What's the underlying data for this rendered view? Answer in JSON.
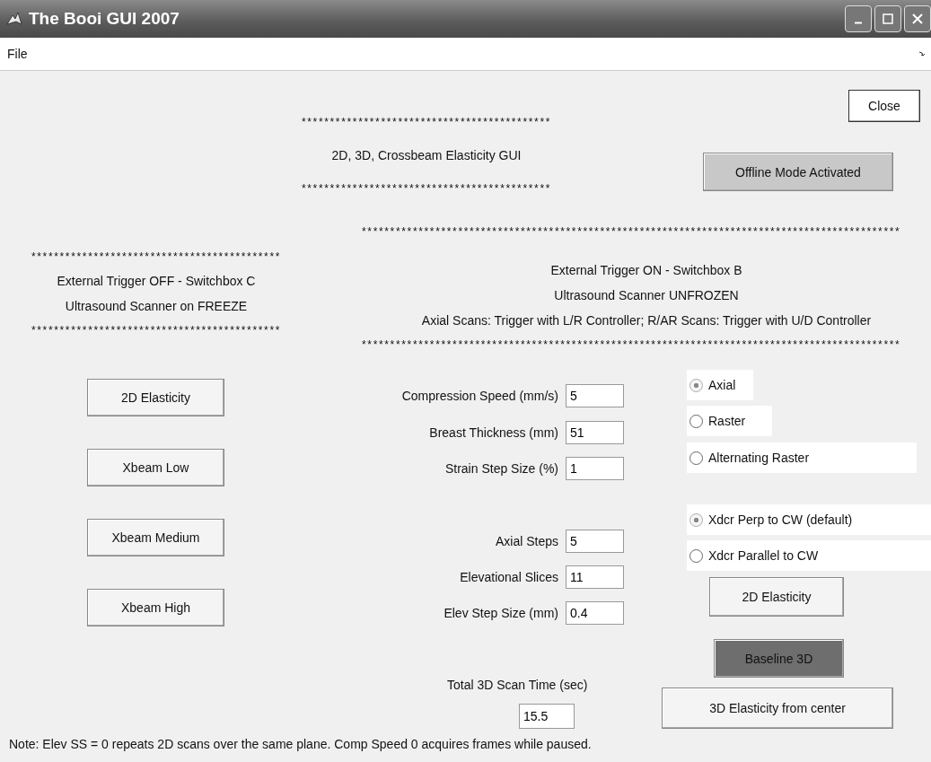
{
  "window": {
    "title": "The Booi GUI 2007"
  },
  "menu": [
    "File"
  ],
  "close_button": "Close",
  "header": {
    "stars_top": "********************************************",
    "title": "2D, 3D, Crossbeam Elasticity GUI",
    "stars_bottom": "********************************************"
  },
  "offline_button": "Offline Mode Activated",
  "left_status": {
    "stars_top": "********************************************",
    "lines": [
      "External Trigger OFF - Switchbox C",
      "Ultrasound Scanner on FREEZE"
    ],
    "stars_bottom": "********************************************"
  },
  "right_status": {
    "stars_top": "***********************************************************************************************",
    "lines": [
      "External Trigger ON - Switchbox B",
      "Ultrasound Scanner UNFROZEN",
      "Axial Scans: Trigger with L/R Controller; R/AR Scans: Trigger with U/D Controller"
    ],
    "stars_bottom": "***********************************************************************************************"
  },
  "left_buttons": [
    "2D Elasticity",
    "Xbeam Low",
    "Xbeam Medium",
    "Xbeam High"
  ],
  "fields": [
    {
      "label": "Compression Speed (mm/s)",
      "value": "5"
    },
    {
      "label": "Breast Thickness (mm)",
      "value": "51"
    },
    {
      "label": "Strain Step Size (%)",
      "value": "1"
    },
    {
      "label": "Axial Steps",
      "value": "5"
    },
    {
      "label": "Elevational Slices",
      "value": "11"
    },
    {
      "label": "Elev Step Size (mm)",
      "value": "0.4"
    }
  ],
  "scan_modes": [
    {
      "label": "Axial",
      "selected": true
    },
    {
      "label": "Raster",
      "selected": false
    },
    {
      "label": "Alternating Raster",
      "selected": false
    }
  ],
  "orientations": [
    {
      "label": "Xdcr Perp to CW (default)",
      "selected": true
    },
    {
      "label": "Xdcr Parallel to CW",
      "selected": false
    }
  ],
  "right_buttons": [
    {
      "label": "2D Elasticity",
      "highlighted": false
    },
    {
      "label": "Baseline 3D",
      "highlighted": true
    },
    {
      "label": "3D Elasticity from center",
      "highlighted": false
    }
  ],
  "total_time": {
    "label": "Total 3D Scan Time (sec)",
    "value": "15.5"
  },
  "note": "Note: Elev SS = 0 repeats 2D scans over the same plane. Comp Speed 0 acquires frames while paused."
}
